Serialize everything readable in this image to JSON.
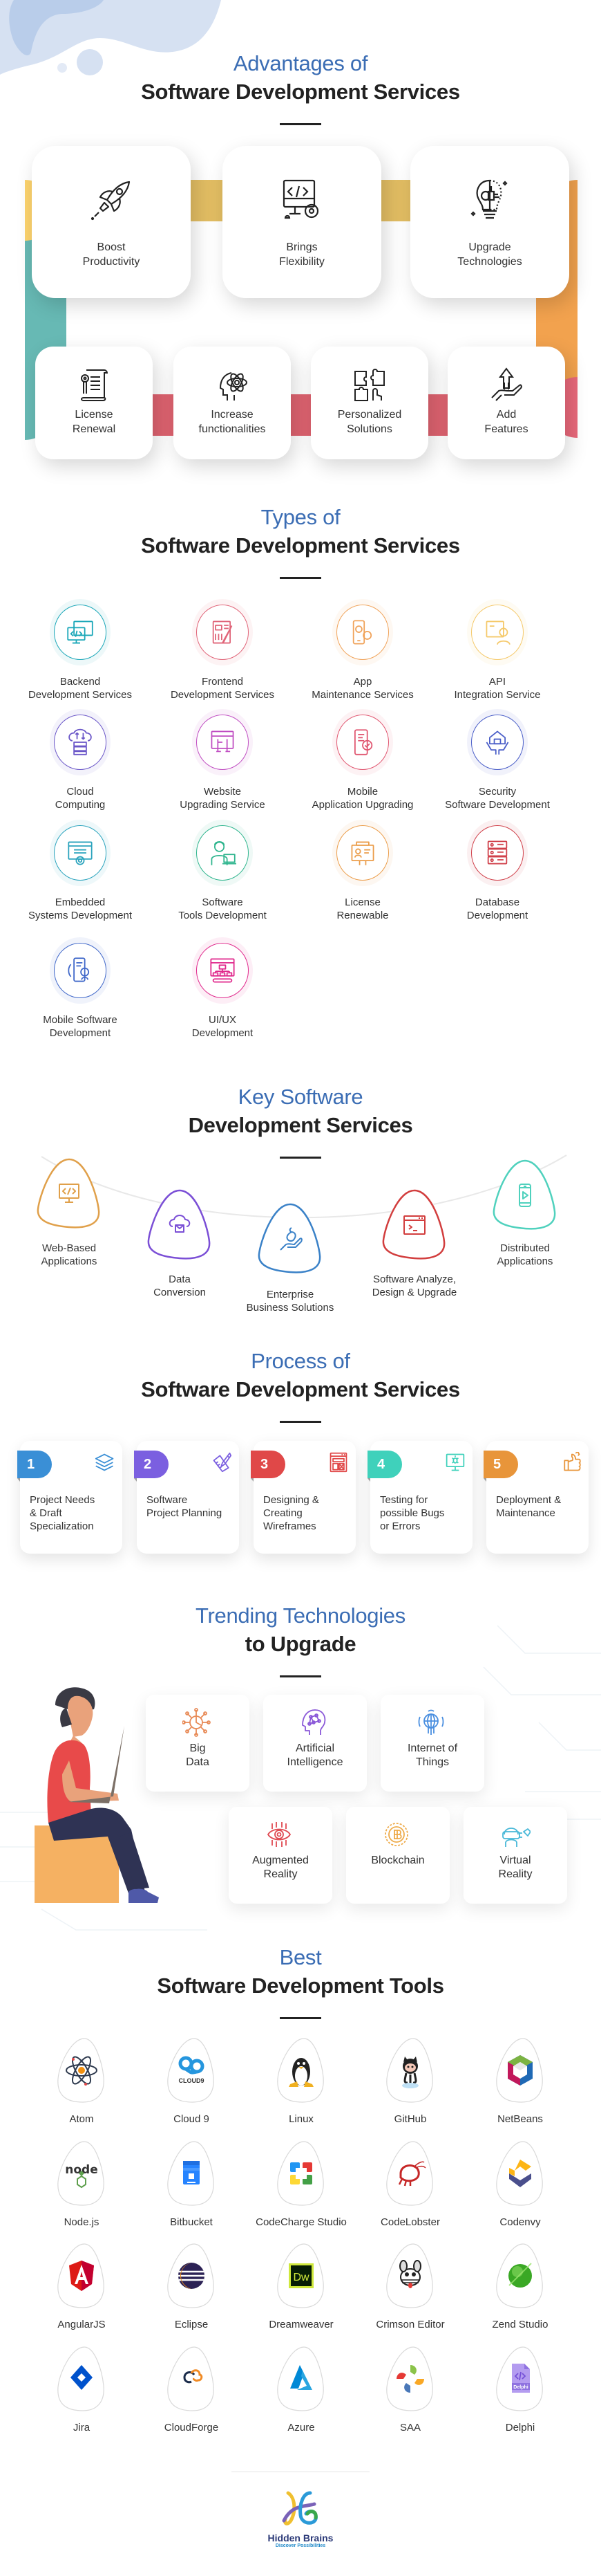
{
  "advantages": {
    "title_line1": "Advantages of",
    "title_line2": "Software Development Services",
    "top_row": [
      {
        "label_line1": "Boost",
        "label_line2": "Productivity",
        "icon": "rocket-icon"
      },
      {
        "label_line1": "Brings",
        "label_line2": "Flexibility",
        "icon": "code-monitor-gear-icon"
      },
      {
        "label_line1": "Upgrade",
        "label_line2": "Technologies",
        "icon": "lightbulb-circuit-icon"
      }
    ],
    "bottom_row": [
      {
        "label_line1": "License",
        "label_line2": "Renewal",
        "icon": "certificate-scroll-icon"
      },
      {
        "label_line1": "Increase",
        "label_line2": "functionalities",
        "icon": "head-atom-icon"
      },
      {
        "label_line1": "Personalized",
        "label_line2": "Solutions",
        "icon": "puzzle-hand-icon"
      },
      {
        "label_line1": "Add",
        "label_line2": "Features",
        "icon": "hand-arrow-up-icon"
      }
    ],
    "colors": {
      "yellow": "#fcd36e",
      "gold": "#e2bd63",
      "teal": "#67b9b4",
      "orange": "#f2a24e",
      "pink": "#e8687a",
      "red_band": "#de6370"
    }
  },
  "types": {
    "title_line1": "Types of",
    "title_line2": "Software Development Services",
    "items": [
      {
        "line1": "Backend",
        "line2": "Development Services",
        "color": "#1aa7b8"
      },
      {
        "line1": "Frontend",
        "line2": "Development Services",
        "color": "#e06478"
      },
      {
        "line1": "App",
        "line2": "Maintenance Services",
        "color": "#f0a35a"
      },
      {
        "line1": "API",
        "line2": "Integration Service",
        "color": "#f5c96a"
      },
      {
        "line1": "Cloud",
        "line2": "Computing",
        "color": "#6a56c8"
      },
      {
        "line1": "Website",
        "line2": "Upgrading Service",
        "color": "#c04ec2"
      },
      {
        "line1": "Mobile",
        "line2": "Application Upgrading",
        "color": "#e05670"
      },
      {
        "line1": "Security",
        "line2": "Software Development",
        "color": "#4a5ec8"
      },
      {
        "line1": "Embedded",
        "line2": "Systems Development",
        "color": "#2aa3bd"
      },
      {
        "line1": "Software",
        "line2": "Tools Development",
        "color": "#2fb58e"
      },
      {
        "line1": "License",
        "line2": "Renewable",
        "color": "#eb9d4a"
      },
      {
        "line1": "Database",
        "line2": "Development",
        "color": "#d0404a"
      },
      {
        "line1": "Mobile Software",
        "line2": "Development",
        "color": "#3f67c9"
      },
      {
        "line1": "UI/UX",
        "line2": "Development",
        "color": "#e0288c"
      }
    ]
  },
  "key_services": {
    "title_line1": "Key Software",
    "title_line2": "Development Services",
    "items": [
      {
        "line1": "Web-Based",
        "line2": "Applications",
        "color": "#e0a04a",
        "icon": "code-monitor-icon"
      },
      {
        "line1": "Data",
        "line2": "Conversion",
        "color": "#7b4fd6",
        "icon": "cloud-transfer-icon"
      },
      {
        "line1": "Enterprise",
        "line2": "Business Solutions",
        "color": "#3b82c8",
        "icon": "hand-apple-icon"
      },
      {
        "line1": "Software Analyze,",
        "line2": "Design & Upgrade",
        "color": "#d23e3e",
        "icon": "terminal-window-icon"
      },
      {
        "line1": "Distributed",
        "line2": "Applications",
        "color": "#4fd1bd",
        "icon": "mobile-play-icon"
      }
    ]
  },
  "process": {
    "title_line1": "Process of",
    "title_line2": "Software Development Services",
    "steps": [
      {
        "number": "1",
        "line1": "Project Needs",
        "line2": "& Draft",
        "line3": "Specialization",
        "color": "#3a8fd6",
        "icon": "layers-icon"
      },
      {
        "number": "2",
        "line1": "Software",
        "line2": "Project Planning",
        "line3": "",
        "color": "#7b5fe0",
        "icon": "ruler-pencil-icon"
      },
      {
        "number": "3",
        "line1": "Designing &",
        "line2": "Creating",
        "line3": "Wireframes",
        "color": "#e04848",
        "icon": "wireframe-icon"
      },
      {
        "number": "4",
        "line1": "Testing for",
        "line2": "possible Bugs",
        "line3": "or Errors",
        "color": "#3fd1bb",
        "icon": "monitor-bug-icon"
      },
      {
        "number": "5",
        "line1": "Deployment &",
        "line2": "Maintenance",
        "line3": "",
        "color": "#e8953a",
        "icon": "thumbs-up-wrench-icon"
      }
    ]
  },
  "trending": {
    "title_line1": "Trending Technologies",
    "title_line2": "to Upgrade",
    "items": [
      {
        "line1": "Big",
        "line2": "Data",
        "color": "#e88a56",
        "icon": "big-data-icon"
      },
      {
        "line1": "Artificial",
        "line2": "Intelligence",
        "color": "#8a58d8",
        "icon": "ai-brain-icon"
      },
      {
        "line1": "Internet of",
        "line2": "Things",
        "color": "#4a8fe0",
        "icon": "iot-globe-icon"
      },
      {
        "line1": "Augmented",
        "line2": "Reality",
        "color": "#e04a52",
        "icon": "ar-eye-icon"
      },
      {
        "line1": "Blockchain",
        "line2": "",
        "color": "#eeab4a",
        "icon": "bitcoin-icon"
      },
      {
        "line1": "Virtual",
        "line2": "Reality",
        "color": "#48b8d8",
        "icon": "vr-headset-icon"
      }
    ]
  },
  "tools": {
    "title_line1": "Best",
    "title_line2": "Software Development Tools",
    "items": [
      {
        "name": "Atom",
        "icon": "atom-logo-icon"
      },
      {
        "name": "Cloud 9",
        "icon": "cloud9-logo-icon"
      },
      {
        "name": "Linux",
        "icon": "linux-penguin-icon"
      },
      {
        "name": "GitHub",
        "icon": "github-octocat-icon"
      },
      {
        "name": "NetBeans",
        "icon": "netbeans-logo-icon"
      },
      {
        "name": "Node.js",
        "icon": "nodejs-logo-icon"
      },
      {
        "name": "Bitbucket",
        "icon": "bitbucket-logo-icon"
      },
      {
        "name": "CodeCharge Studio",
        "icon": "codecharge-logo-icon"
      },
      {
        "name": "CodeLobster",
        "icon": "codelobster-logo-icon"
      },
      {
        "name": "Codenvy",
        "icon": "codenvy-logo-icon"
      },
      {
        "name": "AngularJS",
        "icon": "angular-logo-icon"
      },
      {
        "name": "Eclipse",
        "icon": "eclipse-logo-icon"
      },
      {
        "name": "Dreamweaver",
        "icon": "dreamweaver-logo-icon"
      },
      {
        "name": "Crimson Editor",
        "icon": "crimson-editor-logo-icon"
      },
      {
        "name": "Zend Studio",
        "icon": "zend-studio-logo-icon"
      },
      {
        "name": "Jira",
        "icon": "jira-logo-icon"
      },
      {
        "name": "CloudForge",
        "icon": "cloudforge-logo-icon"
      },
      {
        "name": "Azure",
        "icon": "azure-logo-icon"
      },
      {
        "name": "SAA",
        "icon": "saa-logo-icon"
      },
      {
        "name": "Delphi",
        "icon": "delphi-logo-icon"
      }
    ],
    "dreamweaver_text": "Dw",
    "delphi_text": "Delphi",
    "nodejs_text": "node",
    "cloud9_text": "CLOUD9"
  },
  "footer": {
    "brand_name": "Hidden Brains",
    "tagline": "Discover Possibilities"
  }
}
